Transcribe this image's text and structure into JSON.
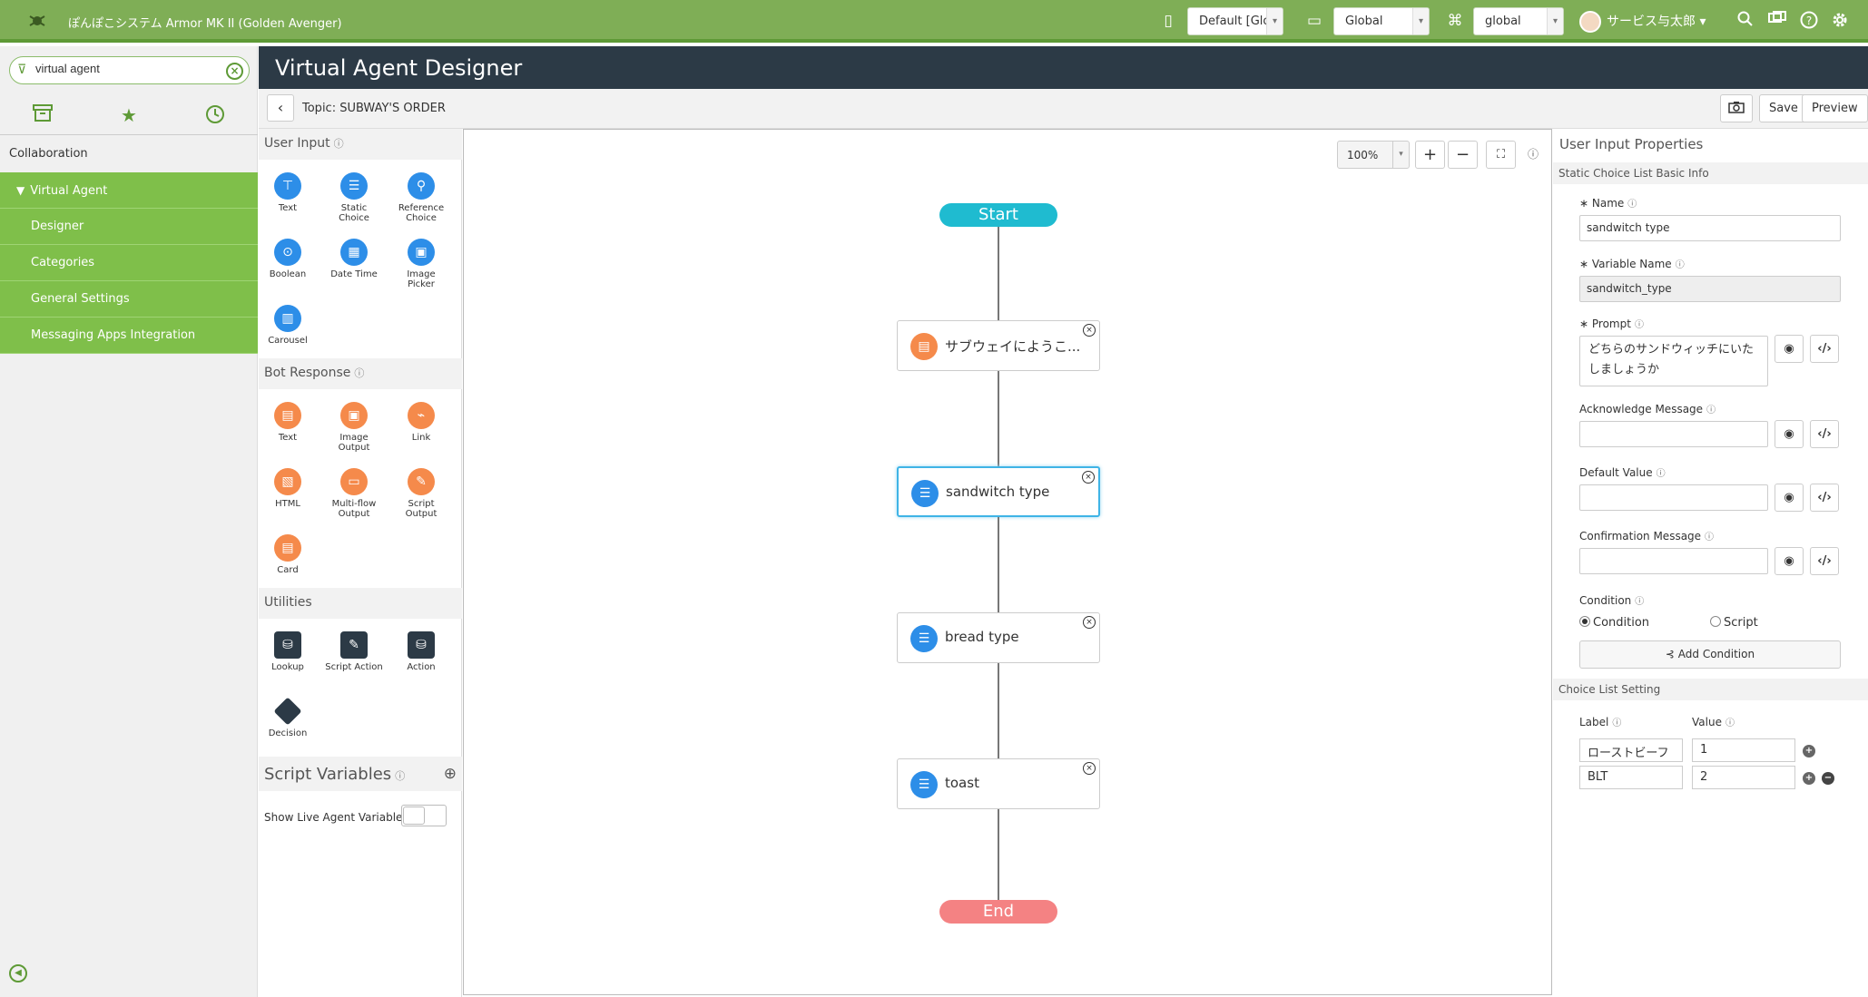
{
  "app": {
    "title": "ぽんぽこシステム Armor MK II (Golden Avenger)"
  },
  "topbar": {
    "update_set": "Default [Glob",
    "scope": "Global",
    "domain": "global",
    "user": "サービス与太郎"
  },
  "nav": {
    "filter_value": "virtual agent",
    "section": "Collaboration",
    "group": "Virtual Agent",
    "items": [
      "Designer",
      "Categories",
      "General Settings",
      "Messaging Apps Integration"
    ]
  },
  "header": {
    "title": "Virtual Agent Designer",
    "topic": "Topic: SUBWAY'S ORDER",
    "save": "Save",
    "preview": "Preview"
  },
  "palette": {
    "user_input": {
      "title": "User Input",
      "items": [
        {
          "label": "Text"
        },
        {
          "label": "Static Choice"
        },
        {
          "label": "Reference Choice"
        },
        {
          "label": "Boolean"
        },
        {
          "label": "Date Time"
        },
        {
          "label": "Image Picker"
        },
        {
          "label": "Carousel"
        }
      ]
    },
    "bot_response": {
      "title": "Bot Response",
      "items": [
        {
          "label": "Text"
        },
        {
          "label": "Image Output"
        },
        {
          "label": "Link"
        },
        {
          "label": "HTML"
        },
        {
          "label": "Multi-flow Output"
        },
        {
          "label": "Script Output"
        },
        {
          "label": "Card"
        }
      ]
    },
    "utilities": {
      "title": "Utilities",
      "items": [
        {
          "label": "Lookup"
        },
        {
          "label": "Script Action"
        },
        {
          "label": "Action"
        },
        {
          "label": "Decision"
        }
      ]
    },
    "script_variables": {
      "title": "Script Variables",
      "show_live": "Show Live Agent Variables"
    }
  },
  "canvas": {
    "zoom": "100%",
    "start": "Start",
    "end": "End",
    "nodes": [
      {
        "label": "サブウェイにようこ..."
      },
      {
        "label": "sandwitch type"
      },
      {
        "label": "bread type"
      },
      {
        "label": "toast"
      }
    ]
  },
  "properties": {
    "title": "User Input Properties",
    "section_basic": "Static Choice List Basic Info",
    "name_label": "Name",
    "name_value": "sandwitch type",
    "varname_label": "Variable Name",
    "varname_value": "sandwitch_type",
    "prompt_label": "Prompt",
    "prompt_value": "どちらのサンドウィッチにいたしましょうか",
    "ack_label": "Acknowledge Message",
    "default_label": "Default Value",
    "confirm_label": "Confirmation Message",
    "condition_label": "Condition",
    "radio_condition": "Condition",
    "radio_script": "Script",
    "add_condition": "Add Condition",
    "section_choice": "Choice List Setting",
    "col_label": "Label",
    "col_value": "Value",
    "rows": [
      {
        "label": "ローストビーフ",
        "value": "1"
      },
      {
        "label": "BLT",
        "value": "2"
      }
    ]
  }
}
